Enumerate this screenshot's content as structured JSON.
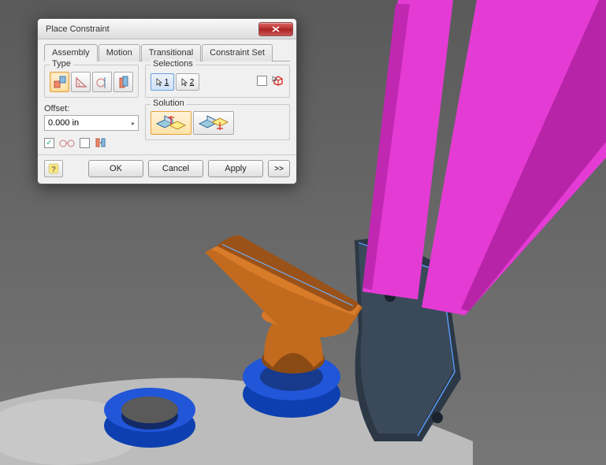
{
  "dialog": {
    "title": "Place Constraint",
    "tabs": [
      {
        "label": "Assembly",
        "active": true
      },
      {
        "label": "Motion",
        "active": false
      },
      {
        "label": "Transitional",
        "active": false
      },
      {
        "label": "Constraint Set",
        "active": false
      }
    ],
    "groups": {
      "type_label": "Type",
      "selections_label": "Selections",
      "solution_label": "Solution",
      "offset_label": "Offset:"
    },
    "offset_value": "0.000 in",
    "selection1": "1",
    "selection2": "2",
    "buttons": {
      "ok": "OK",
      "cancel": "Cancel",
      "apply": "Apply",
      "expand": ">>"
    },
    "checkboxes": {
      "predict": true,
      "show_preview": false
    },
    "icons": {
      "mate": "mate-icon",
      "angle": "angle-icon",
      "tangent": "tangent-icon",
      "insert": "insert-icon",
      "pick1": "pick-arrow-icon",
      "pick2": "pick-arrow-icon",
      "pick_part": "pick-part-icon",
      "solution_mate": "solution-mate-icon",
      "solution_flush": "solution-flush-icon",
      "help": "help-icon",
      "close": "close-x-icon",
      "preview_glasses": "preview-glasses-icon",
      "limits": "limits-icon"
    }
  }
}
